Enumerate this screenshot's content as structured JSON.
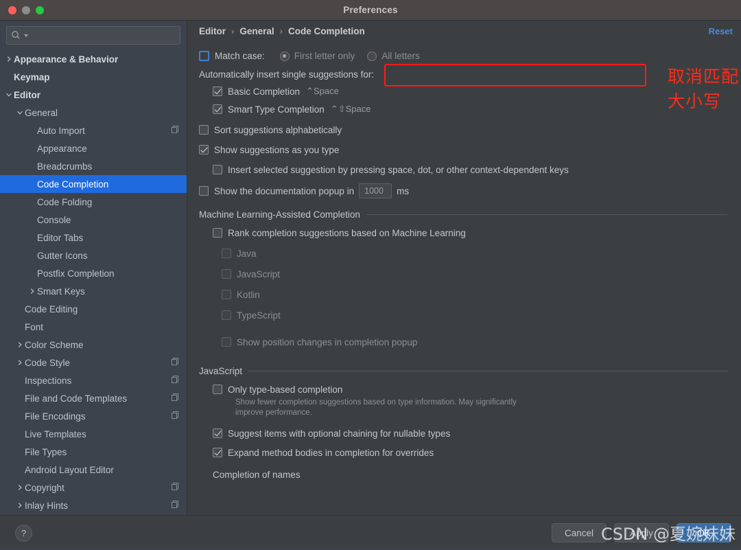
{
  "window": {
    "title": "Preferences",
    "traffic_lights": [
      "close",
      "minimize",
      "zoom"
    ]
  },
  "sidebar": {
    "search": {
      "value": "",
      "placeholder": ""
    },
    "items": [
      {
        "label": "Appearance & Behavior",
        "level": 0,
        "arrow": "collapsed",
        "copy": false,
        "selected": false
      },
      {
        "label": "Keymap",
        "level": 0,
        "arrow": "none",
        "copy": false,
        "selected": false
      },
      {
        "label": "Editor",
        "level": 0,
        "arrow": "expanded",
        "copy": false,
        "selected": false
      },
      {
        "label": "General",
        "level": 1,
        "arrow": "expanded",
        "copy": false,
        "selected": false
      },
      {
        "label": "Auto Import",
        "level": 2,
        "arrow": "none",
        "copy": true,
        "selected": false
      },
      {
        "label": "Appearance",
        "level": 2,
        "arrow": "none",
        "copy": false,
        "selected": false
      },
      {
        "label": "Breadcrumbs",
        "level": 2,
        "arrow": "none",
        "copy": false,
        "selected": false
      },
      {
        "label": "Code Completion",
        "level": 2,
        "arrow": "none",
        "copy": false,
        "selected": true
      },
      {
        "label": "Code Folding",
        "level": 2,
        "arrow": "none",
        "copy": false,
        "selected": false
      },
      {
        "label": "Console",
        "level": 2,
        "arrow": "none",
        "copy": false,
        "selected": false
      },
      {
        "label": "Editor Tabs",
        "level": 2,
        "arrow": "none",
        "copy": false,
        "selected": false
      },
      {
        "label": "Gutter Icons",
        "level": 2,
        "arrow": "none",
        "copy": false,
        "selected": false
      },
      {
        "label": "Postfix Completion",
        "level": 2,
        "arrow": "none",
        "copy": false,
        "selected": false
      },
      {
        "label": "Smart Keys",
        "level": 2,
        "arrow": "collapsed",
        "copy": false,
        "selected": false
      },
      {
        "label": "Code Editing",
        "level": 1,
        "arrow": "none",
        "copy": false,
        "selected": false
      },
      {
        "label": "Font",
        "level": 1,
        "arrow": "none",
        "copy": false,
        "selected": false
      },
      {
        "label": "Color Scheme",
        "level": 1,
        "arrow": "collapsed",
        "copy": false,
        "selected": false
      },
      {
        "label": "Code Style",
        "level": 1,
        "arrow": "collapsed",
        "copy": true,
        "selected": false
      },
      {
        "label": "Inspections",
        "level": 1,
        "arrow": "none",
        "copy": true,
        "selected": false
      },
      {
        "label": "File and Code Templates",
        "level": 1,
        "arrow": "none",
        "copy": true,
        "selected": false
      },
      {
        "label": "File Encodings",
        "level": 1,
        "arrow": "none",
        "copy": true,
        "selected": false
      },
      {
        "label": "Live Templates",
        "level": 1,
        "arrow": "none",
        "copy": false,
        "selected": false
      },
      {
        "label": "File Types",
        "level": 1,
        "arrow": "none",
        "copy": false,
        "selected": false
      },
      {
        "label": "Android Layout Editor",
        "level": 1,
        "arrow": "none",
        "copy": false,
        "selected": false
      },
      {
        "label": "Copyright",
        "level": 1,
        "arrow": "collapsed",
        "copy": true,
        "selected": false
      },
      {
        "label": "Inlay Hints",
        "level": 1,
        "arrow": "collapsed",
        "copy": true,
        "selected": false
      }
    ]
  },
  "breadcrumb": {
    "parts": [
      "Editor",
      "General",
      "Code Completion"
    ],
    "separator": "›",
    "reset_label": "Reset"
  },
  "settings": {
    "match_case": {
      "label": "Match case:",
      "checked": false,
      "options": [
        {
          "label": "First letter only",
          "selected": true,
          "enabled": false
        },
        {
          "label": "All letters",
          "selected": false,
          "enabled": false
        }
      ]
    },
    "auto_insert_header": "Automatically insert single suggestions for:",
    "auto_insert_items": [
      {
        "label": "Basic Completion",
        "shortcut": "⌃Space",
        "checked": true
      },
      {
        "label": "Smart Type Completion",
        "shortcut": "⌃⇧Space",
        "checked": true
      }
    ],
    "sort_alphabetically": {
      "label": "Sort suggestions alphabetically",
      "checked": false
    },
    "show_as_you_type": {
      "label": "Show suggestions as you type",
      "checked": true
    },
    "insert_selected": {
      "label": "Insert selected suggestion by pressing space, dot, or other context-dependent keys",
      "checked": false
    },
    "doc_popup": {
      "label_before": "Show the documentation popup in",
      "value": "1000",
      "label_after": "ms",
      "checked": false
    },
    "ml_section": {
      "title": "Machine Learning-Assisted Completion",
      "rank_label": "Rank completion suggestions based on Machine Learning",
      "rank_checked": false,
      "languages": [
        {
          "label": "Java",
          "checked": false,
          "enabled": false
        },
        {
          "label": "JavaScript",
          "checked": false,
          "enabled": false
        },
        {
          "label": "Kotlin",
          "checked": false,
          "enabled": false
        },
        {
          "label": "TypeScript",
          "checked": false,
          "enabled": false
        }
      ],
      "position_changes": {
        "label": "Show position changes in completion popup",
        "checked": false,
        "enabled": false
      }
    },
    "javascript_section": {
      "title": "JavaScript",
      "only_type_based": {
        "label": "Only type-based completion",
        "checked": false,
        "note": "Show fewer completion suggestions based on type information. May significantly improve performance."
      },
      "optional_chaining": {
        "label": "Suggest items with optional chaining for nullable types",
        "checked": true
      },
      "expand_method": {
        "label": "Expand method bodies in completion for overrides",
        "checked": true
      },
      "completion_of_names": "Completion of names"
    }
  },
  "annotations": {
    "highlight_text": "取消匹配大小写",
    "highlight_color": "#ff1a1a"
  },
  "footer": {
    "help_label": "?",
    "buttons": [
      {
        "label": "Cancel",
        "primary": false
      },
      {
        "label": "Apply",
        "primary": false
      },
      {
        "label": "OK",
        "primary": true
      }
    ]
  },
  "watermark": {
    "text": "CSDN @夏婉妹妹"
  }
}
